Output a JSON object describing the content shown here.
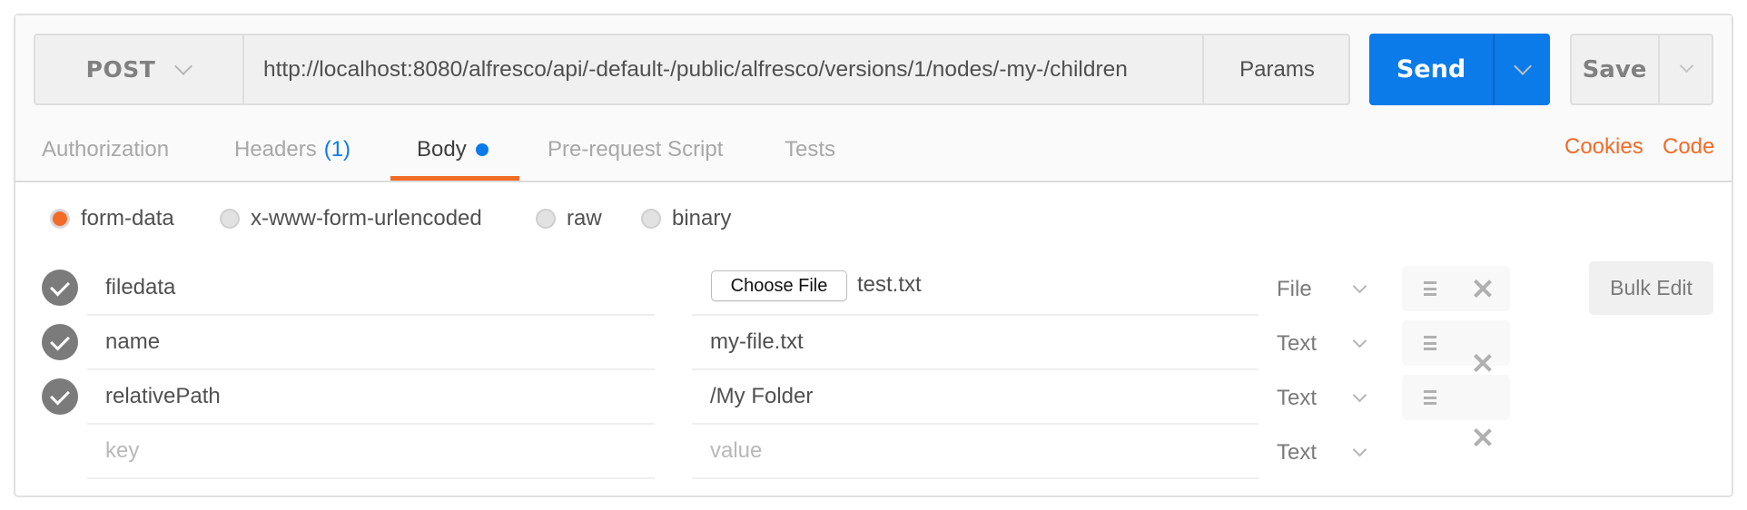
{
  "request": {
    "method": "POST",
    "url": "http://localhost:8080/alfresco/api/-default-/public/alfresco/versions/1/nodes/-my-/children",
    "params_label": "Params",
    "send_label": "Send",
    "save_label": "Save"
  },
  "tabs": [
    {
      "label": "Authorization"
    },
    {
      "label": "Headers",
      "count": "(1)"
    },
    {
      "label": "Body",
      "active": true,
      "indicator": "modified-dot"
    },
    {
      "label": "Pre-request Script"
    },
    {
      "label": "Tests"
    }
  ],
  "links": {
    "cookies": "Cookies",
    "code": "Code"
  },
  "body_types": [
    {
      "label": "form-data",
      "selected": true
    },
    {
      "label": "x-www-form-urlencoded",
      "selected": false
    },
    {
      "label": "raw",
      "selected": false
    },
    {
      "label": "binary",
      "selected": false
    }
  ],
  "form_rows": [
    {
      "enabled": true,
      "key": "filedata",
      "value": "test.txt",
      "choose_file_label": "Choose File",
      "type": "File"
    },
    {
      "enabled": true,
      "key": "name",
      "value": "my-file.txt",
      "type": "Text"
    },
    {
      "enabled": true,
      "key": "relativePath",
      "value": "/My Folder",
      "type": "Text"
    }
  ],
  "new_row": {
    "key_placeholder": "key",
    "value_placeholder": "value",
    "type": "Text"
  },
  "bulk_edit_label": "Bulk Edit",
  "colors": {
    "accent_orange": "#f26b27",
    "primary_blue": "#0b7bea",
    "check_gray": "#7b7b7b"
  }
}
